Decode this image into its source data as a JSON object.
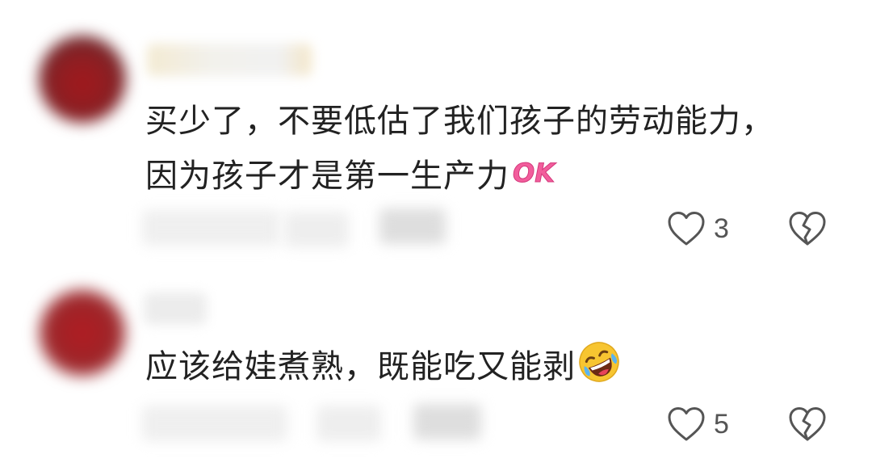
{
  "comments": [
    {
      "text": "买少了，不要低估了我们孩子的劳动能力，因为孩子才是第一生产力",
      "sticker": "OK",
      "likes": "3",
      "heart_icon": "heart-outline",
      "dislike_icon": "broken-heart-outline"
    },
    {
      "text": "应该给娃煮熟，既能吃又能剥",
      "emoji": "rolling-on-floor-laughing",
      "likes": "5",
      "heart_icon": "heart-outline",
      "dislike_icon": "broken-heart-outline"
    }
  ],
  "colors": {
    "text": "#222222",
    "icon": "#555555",
    "sticker_pink": "#f25d9c",
    "emoji_yellow": "#f7c531"
  }
}
